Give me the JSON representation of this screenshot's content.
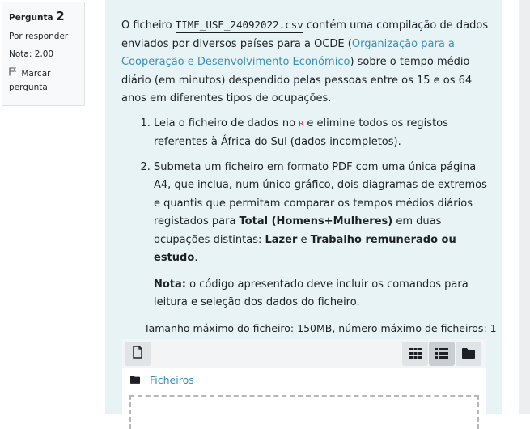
{
  "question_info": {
    "label": "Pergunta",
    "number": "2",
    "status": "Por responder",
    "grade": "Nota: 2,00",
    "flag_label": "Marcar pergunta"
  },
  "question": {
    "intro_before": "O ficheiro ",
    "filename": "TIME_USE_24092022.csv",
    "intro_after": " contém uma compilação de dados enviados por diversos países para a OCDE (",
    "org_link": "Organização para a Cooperação e Desenvolvimento Económico",
    "intro_end": ") sobre o tempo médio diário (em minutos) despendido pelas pessoas entre os 15 e os 64 anos em diferentes tipos de ocupações.",
    "item1_before": "Leia o ficheiro de dados no ",
    "item1_code": "R",
    "item1_after": " e elimine todos os registos referentes à África do Sul (dados incompletos).",
    "item2_text": "Submeta um ficheiro em formato PDF com uma única página A4, que inclua, num único gráfico, dois diagramas de extremos e quantis que permitam comparar os tempos médios diários registados para ",
    "item2_bold1": "Total (Homens+Mulheres)",
    "item2_mid": " em duas ocupações distintas: ",
    "item2_bold2": "Lazer",
    "item2_and": " e ",
    "item2_bold3": "Trabalho remunerado ou estudo",
    "item2_end": ".",
    "note_label": "Nota:",
    "note_text": " o código apresentado deve incluir os comandos para leitura e seleção dos dados do ficheiro."
  },
  "upload": {
    "max_size_text": "Tamanho máximo do ficheiro: 150MB, número máximo de ficheiros: 1",
    "folder_label": "Ficheiros",
    "icons": [
      "file-icon",
      "grid-icon",
      "list-icon",
      "folder-icon"
    ]
  }
}
